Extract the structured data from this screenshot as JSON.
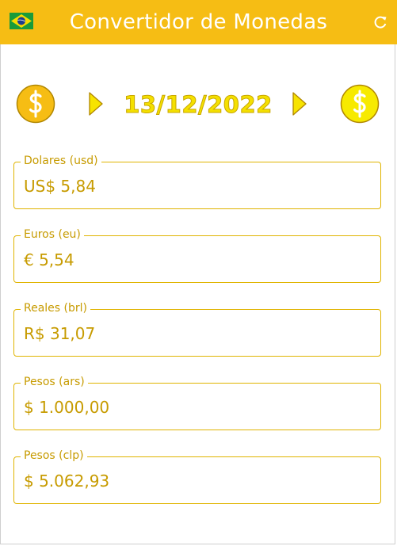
{
  "app": {
    "title": "Convertidor de Monedas"
  },
  "icons": {
    "flag": "brazil-flag-icon",
    "refresh": "refresh-icon",
    "coin": "dollar-coin-icon",
    "arrow": "play-arrow-icon"
  },
  "colors": {
    "appbar": "#f6bd14",
    "coin_left": "#f6bd14",
    "coin_right": "#f7ea00",
    "label": "#c79b00",
    "border": "#e0b400",
    "date": "#f4e000"
  },
  "date": "13/12/2022",
  "currencies": [
    {
      "label": "Dolares (usd)",
      "value": "US$ 5,84"
    },
    {
      "label": "Euros (eu)",
      "value": "€ 5,54"
    },
    {
      "label": "Reales (brl)",
      "value": "R$ 31,07"
    },
    {
      "label": "Pesos (ars)",
      "value": "$ 1.000,00"
    },
    {
      "label": "Pesos (clp)",
      "value": "$ 5.062,93"
    }
  ]
}
